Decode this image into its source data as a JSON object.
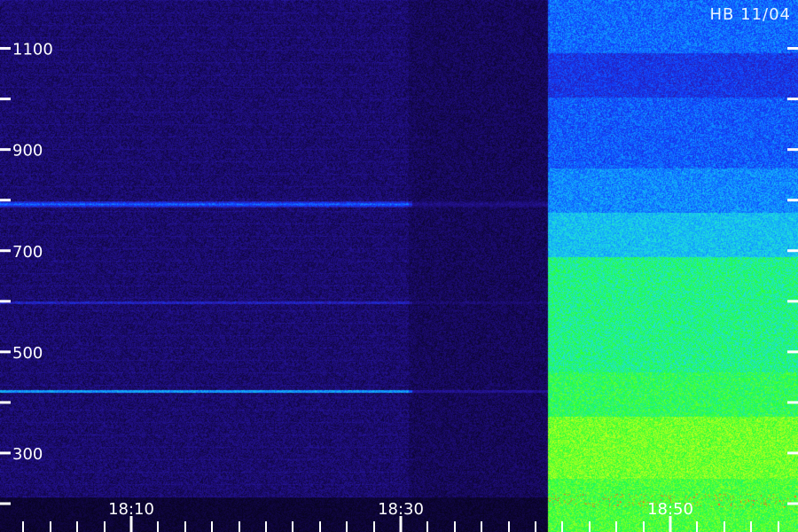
{
  "station_label": "HB 11/04",
  "y_axis": {
    "labeled_ticks": [
      {
        "value": 1100,
        "label": "1100"
      },
      {
        "value": 900,
        "label": "900"
      },
      {
        "value": 700,
        "label": "700"
      },
      {
        "value": 500,
        "label": "500"
      },
      {
        "value": 300,
        "label": "300"
      }
    ],
    "minor_ticks": [
      1000,
      800,
      600,
      400,
      200
    ],
    "range": [
      200,
      1200
    ]
  },
  "x_axis": {
    "labeled_ticks": [
      {
        "time": "18:10",
        "label": "18:10"
      },
      {
        "time": "18:30",
        "label": "18:30"
      },
      {
        "time": "18:50",
        "label": "18:50"
      }
    ],
    "minor_step_minutes": 2
  },
  "colormap": [
    "#000000",
    "#1a0a6a",
    "#2a1ab0",
    "#1040ff",
    "#10a0ff",
    "#20e0e0",
    "#20ff40",
    "#a0ff20",
    "#ffff20",
    "#ff4020"
  ]
}
